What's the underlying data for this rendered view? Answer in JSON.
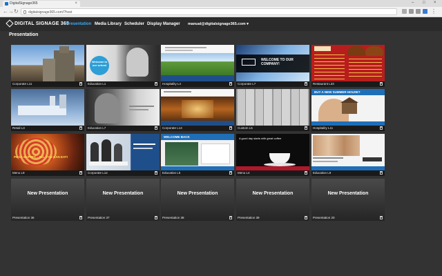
{
  "browser": {
    "tab_title": "DigitalSignage365",
    "url": "digitalsignage365.com/?host",
    "nav": {
      "back": "←",
      "forward": "→",
      "reload": "↻"
    },
    "window_controls": {
      "minimize": "–",
      "maximize": "□",
      "close": "×"
    }
  },
  "header": {
    "logo": "DIGITAL SIGNAGE 365",
    "menu": [
      "Presentation",
      "Media Library",
      "Scheduler",
      "Display Manager"
    ],
    "active_menu": "Presentation",
    "user": "manual@digitalsignage365.com ▾"
  },
  "page_title": "Presentation",
  "tiles": [
    {
      "caption": "Corporate L11"
    },
    {
      "caption": "Education L1",
      "overlay": "Welcome to our school"
    },
    {
      "caption": "Hospitality L4"
    },
    {
      "caption": "Corporate L7",
      "overlay": "WELCOME TO OUR COMPANY!"
    },
    {
      "caption": "Restaurant L33"
    },
    {
      "caption": "Retail L3"
    },
    {
      "caption": "Education L7"
    },
    {
      "caption": "Corporate L14"
    },
    {
      "caption": "Custom L5"
    },
    {
      "caption": "Hospitality L11",
      "overlay": "BUY A NEW SUMMER HOUSE?"
    },
    {
      "caption": "Menu L9",
      "overlay": "PIZZA BUFFET... ALL YOU CAN EAT!"
    },
    {
      "caption": "Corporate L12"
    },
    {
      "caption": "Education L5",
      "overlay": "WELCOME BACK"
    },
    {
      "caption": "Menu L4",
      "overlay": "A good day starts with great coffee"
    },
    {
      "caption": "Education L9"
    },
    {
      "caption": "Presentation 36",
      "new_label": "New Presentation"
    },
    {
      "caption": "Presentation 37",
      "new_label": "New Presentation"
    },
    {
      "caption": "Presentation 38",
      "new_label": "New Presentation"
    },
    {
      "caption": "Presentation 39",
      "new_label": "New Presentation"
    },
    {
      "caption": "Presentation 20",
      "new_label": "New Presentation"
    }
  ],
  "colors": {
    "accent": "#3fa9f5",
    "background": "#333333",
    "header": "#2b2b2b"
  }
}
